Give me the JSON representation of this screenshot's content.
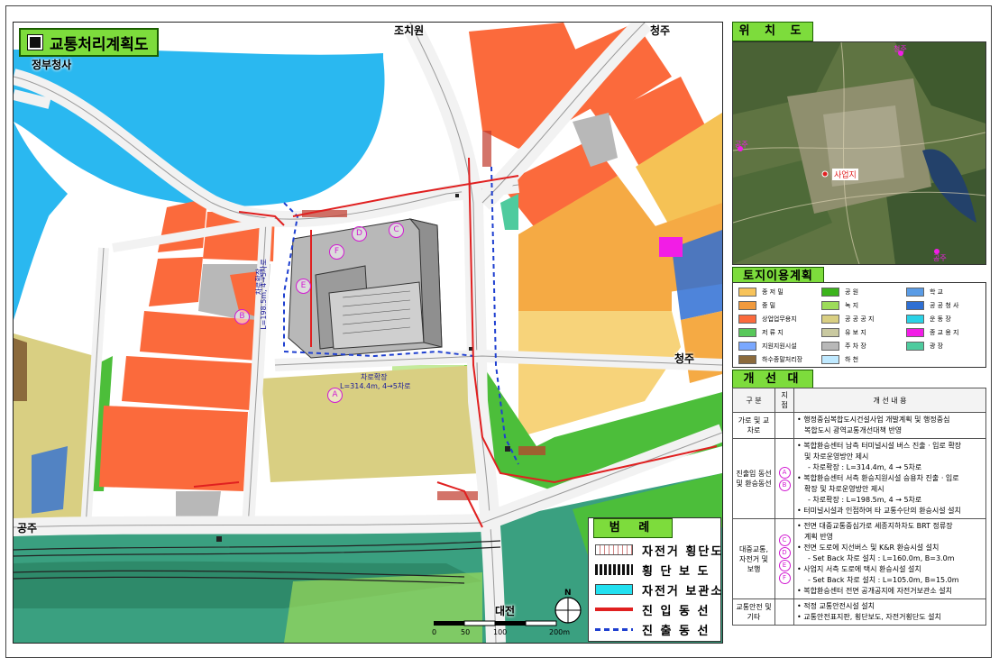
{
  "map": {
    "title": "교통처리계획도",
    "place_labels": {
      "jochiwon": "조치원",
      "cheongju_top": "청주",
      "government": "정부청사",
      "cheongju_right": "청주",
      "gongju": "공주",
      "daejeon": "대전"
    },
    "road_labels": {
      "lane_a_title": "차로확장",
      "lane_a_spec": "L=314.4m, 4→5차로",
      "lane_b_title": "차로확장",
      "lane_b_spec": "L=198.5m, 4→5차로"
    },
    "markers": [
      "A",
      "B",
      "C",
      "D",
      "E",
      "F"
    ],
    "legend": {
      "title": "범 례",
      "items": [
        {
          "label": "자전거 횡단도"
        },
        {
          "label": "횡 단 보 도"
        },
        {
          "label": "자전거 보관소"
        },
        {
          "label": "진 입 동 선"
        },
        {
          "label": "진 출 동 선"
        }
      ]
    },
    "scale": {
      "ticks": [
        "0",
        "50",
        "100",
        "200m"
      ]
    },
    "north": "N",
    "colors": {
      "water": "#2ab8f0",
      "commercial": "#fb6a3c",
      "residential": "#f5aa44",
      "park": "#4cbe3a",
      "open": "#d9cf82",
      "rail": "#3aa080",
      "road": "#ffffff"
    }
  },
  "location": {
    "title": "위 치 도",
    "site_label": "사업지",
    "cheongju": "청주",
    "sejong": "공주",
    "mu": "공주"
  },
  "landuse": {
    "title": "토지이용계획",
    "items": [
      {
        "label": "종 저 밀",
        "color": "#f7c35a"
      },
      {
        "label": "공 원",
        "color": "#3cb41c"
      },
      {
        "label": "학 교",
        "color": "#5a9ce6"
      },
      {
        "label": "중 밀",
        "color": "#f19a3d"
      },
      {
        "label": "녹 지",
        "color": "#9ddc5a"
      },
      {
        "label": "공 공 청 사",
        "color": "#2f6fd3"
      },
      {
        "label": "상업업무용지",
        "color": "#fb6a3c"
      },
      {
        "label": "공 공 공 지",
        "color": "#d9cf82"
      },
      {
        "label": "운 동 장",
        "color": "#2ad2e6"
      },
      {
        "label": "저 류 지",
        "color": "#58c85a"
      },
      {
        "label": "유 보 지",
        "color": "#c9c9a0"
      },
      {
        "label": "종 교 용 지",
        "color": "#f21de6"
      },
      {
        "label": "지원지원시설",
        "color": "#7aa8ff"
      },
      {
        "label": "주 차 장",
        "color": "#b8b8b8"
      },
      {
        "label": "광 장",
        "color": "#4ecb9e"
      },
      {
        "label": "하수종말처리장",
        "color": "#8b6a3c"
      },
      {
        "label": "하 천",
        "color": "#bfe9ff"
      }
    ]
  },
  "plan": {
    "title": "개 선 대 책",
    "headers": [
      "구 분",
      "지점",
      "개 선 내 용"
    ],
    "rows": [
      {
        "category": "가로 및 교차로",
        "points": [],
        "lines": [
          "• 행정중심복합도시건설사업 개발계획 및 행정중심",
          "복합도시 광역교통개선대책 반영"
        ]
      },
      {
        "category": "진출입 동선 및 환승동선",
        "points": [
          "A",
          "B"
        ],
        "lines": [
          "• 복합환승센터 남측 터미널시설 버스 진출 · 입로 확장",
          "및 차로운영방안 제시",
          "- 차로확장 : L=314.4m, 4 → 5차로",
          "• 복합환승센터 서측 환승지원시설 승용차 진출 · 입로",
          "확장 및 차로운영방안 제시",
          "- 차로확장 : L=198.5m, 4 → 5차로",
          "• 터미널시설과 인접하여 타 교통수단의 환승시설 설치"
        ]
      },
      {
        "category": "대중교통, 자전거 및 보행",
        "points": [
          "C",
          "D",
          "E",
          "F"
        ],
        "lines": [
          "• 전면 대중교통중심가로 세종지하차도 BRT 정류장",
          "계획 반영",
          "• 전면 도로에 지선버스 및 K&R 환승시설 설치",
          "- Set Back 차로 설치 : L=160.0m, B=3.0m",
          "• 사업지 서측 도로에 택시 환승시설 설치",
          "- Set Back 차로 설치 : L=105.0m, B=15.0m",
          "• 복합환승센터 전면 공개공지에 자전거보관소 설치"
        ]
      },
      {
        "category": "교통안전 및 기타",
        "points": [],
        "lines": [
          "• 적정 교통안전시설 설치",
          "• 교통안전표지판, 횡단보도, 자전거횡단도 설치"
        ]
      }
    ]
  }
}
